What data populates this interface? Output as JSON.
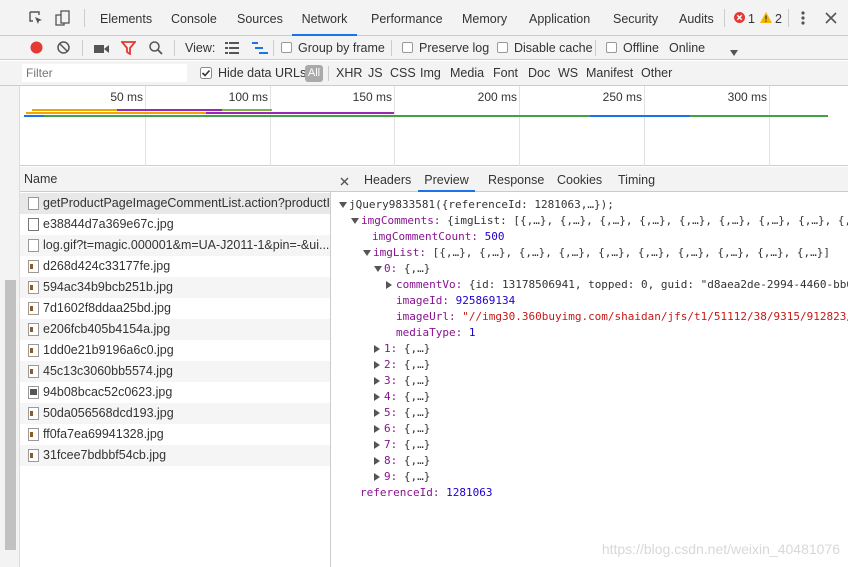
{
  "devtools_tabs": [
    "Elements",
    "Console",
    "Sources",
    "Network",
    "Performance",
    "Memory",
    "Application",
    "Security",
    "Audits"
  ],
  "active_tab": "Network",
  "counts": {
    "errors": "1",
    "warnings": "2"
  },
  "toolbar": {
    "view_label": "View:",
    "group_by_frame": "Group by frame",
    "preserve_log": "Preserve log",
    "disable_cache": "Disable cache",
    "offline": "Offline",
    "throttle": "Online"
  },
  "filter": {
    "placeholder": "Filter",
    "hide_data_urls": "Hide data URLs",
    "types": [
      "All",
      "XHR",
      "JS",
      "CSS",
      "Img",
      "Media",
      "Font",
      "Doc",
      "WS",
      "Manifest",
      "Other"
    ]
  },
  "timeline": {
    "ticks": [
      "50 ms",
      "100 ms",
      "150 ms",
      "200 ms",
      "250 ms",
      "300 ms"
    ]
  },
  "list": {
    "header": "Name",
    "rows": [
      {
        "name": "getProductPageImageCommentList.action?productI...",
        "icon": "doc"
      },
      {
        "name": "e38844d7a369e67c.jpg",
        "icon": "img"
      },
      {
        "name": "log.gif?t=magic.000001&m=UA-J2011-1&pin=-&ui...",
        "icon": "doc"
      },
      {
        "name": "d268d424c33177fe.jpg",
        "icon": "img"
      },
      {
        "name": "594ac34b9bcb251b.jpg",
        "icon": "img"
      },
      {
        "name": "7d1602f8ddaa25bd.jpg",
        "icon": "img"
      },
      {
        "name": "e206fcb405b4154a.jpg",
        "icon": "img"
      },
      {
        "name": "1dd0e21b9196a6c0.jpg",
        "icon": "img"
      },
      {
        "name": "45c13c3060bb5574.jpg",
        "icon": "img"
      },
      {
        "name": "94b08bcac52c0623.jpg",
        "icon": "dark"
      },
      {
        "name": "50da056568dcd193.jpg",
        "icon": "img"
      },
      {
        "name": "ff0fa7ea69941328.jpg",
        "icon": "img"
      },
      {
        "name": "31fcee7bdbbf54cb.jpg",
        "icon": "img"
      }
    ]
  },
  "detail_tabs": [
    "Headers",
    "Preview",
    "Response",
    "Cookies",
    "Timing"
  ],
  "active_detail_tab": "Preview",
  "preview": {
    "root": "jQuery9833581({referenceId: 1281063,…});",
    "img_comments_key": "imgComments:",
    "img_comments_val": "{imgList: [{,…}, {,…}, {,…}, {,…}, {,…}, {,…}, {,…}, {,…}, {,…",
    "img_comment_count_key": "imgCommentCount:",
    "img_comment_count_val": "500",
    "img_list_key": "imgList:",
    "img_list_val": "[{,…}, {,…}, {,…}, {,…}, {,…}, {,…}, {,…}, {,…}, {,…}, {,…}]",
    "item0_key": "0:",
    "item0_val": "{,…}",
    "comment_vo_key": "commentVo:",
    "comment_vo_val": "{id: 13178506941, topped: 0, guid: \"d8aea2de-2994-4460-bb6",
    "image_id_key": "imageId:",
    "image_id_val": "925869134",
    "image_url_key": "imageUrl:",
    "image_url_val": "\"//img30.360buyimg.com/shaidan/jfs/t1/51112/38/9315/912823/",
    "media_type_key": "mediaType:",
    "media_type_val": "1",
    "collapsed_items": [
      "1:",
      "2:",
      "3:",
      "4:",
      "5:",
      "6:",
      "7:",
      "8:",
      "9:"
    ],
    "collapsed_val": "{,…}",
    "reference_id_key": "referenceId:",
    "reference_id_val": "1281063"
  },
  "watermark": "https://blog.csdn.net/weixin_40481076"
}
